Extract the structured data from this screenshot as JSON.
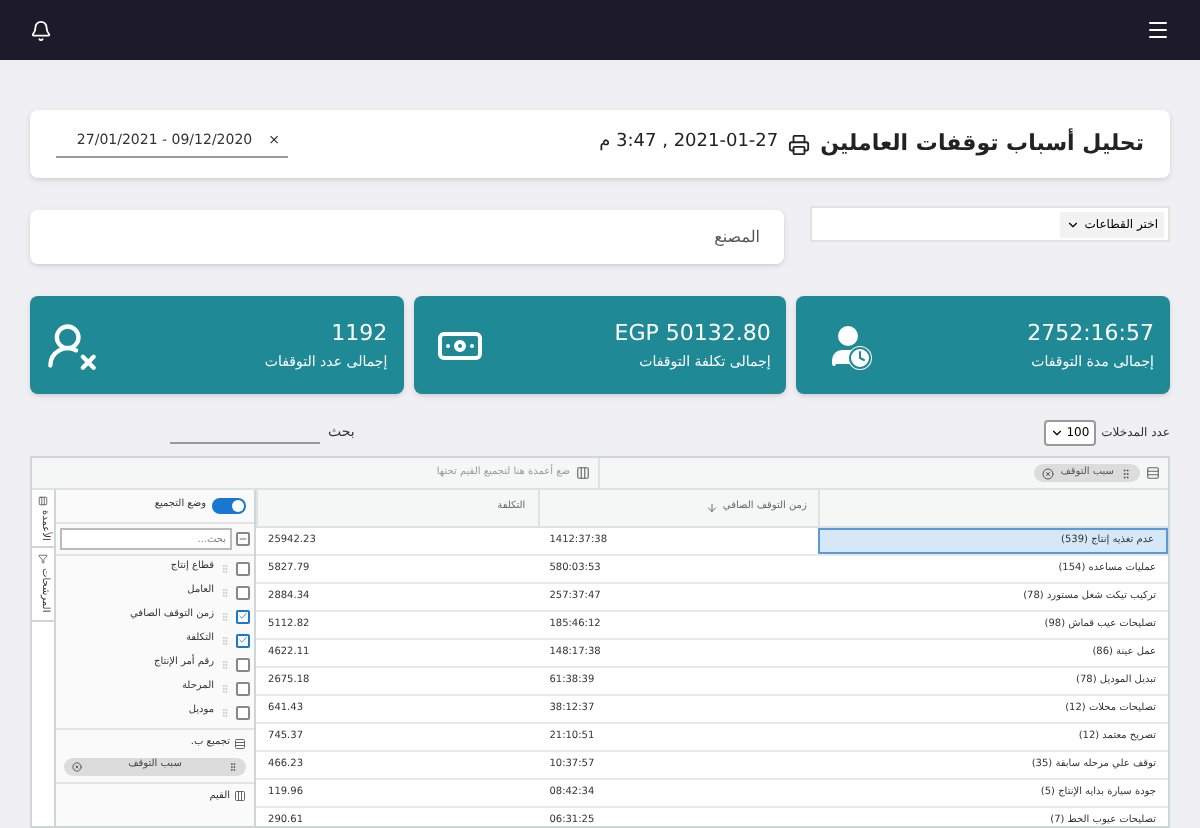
{
  "header": {
    "title": "تحليل أسباب توقفات العاملين",
    "datetime": "2021-01-27 , 3:47 م",
    "date_range": "09/12/2020 - 27/01/2021",
    "clear": "×"
  },
  "sector_select": {
    "label": "اختر القطاعات"
  },
  "factory_card": {
    "label": "المصنع"
  },
  "kpis": [
    {
      "kind": "duration",
      "value": "2752:16:57",
      "label": "إجمالى مدة التوقفات"
    },
    {
      "kind": "cost",
      "value": "EGP 50132.80",
      "label": "إجمالى تكلفة التوقفات"
    },
    {
      "kind": "count",
      "value": "1192",
      "label": "إجمالى عدد التوقفات"
    }
  ],
  "entries": {
    "label": "عدد المدخلات",
    "value": "100"
  },
  "search": {
    "label": "بحث"
  },
  "grid": {
    "group_chip": "سبب التوقف",
    "drop_hint": "ضع أعمدة هنا لتجميع القيم تحتها",
    "columns": [
      {
        "label": "زمن التوقف الصافي",
        "sorted": true
      },
      {
        "label": "التكلفة",
        "sorted": false
      }
    ],
    "rows": [
      {
        "cause": "عدم تغذيه إنتاج (539)",
        "time": "1412:37:38",
        "cost": "25942.23",
        "selected": true
      },
      {
        "cause": "عمليات مساعده (154)",
        "time": "580:03:53",
        "cost": "5827.79",
        "selected": false
      },
      {
        "cause": "تركيب تيكت شغل مستورد (78)",
        "time": "257:37:47",
        "cost": "2884.34",
        "selected": false
      },
      {
        "cause": "تصليحات عيب قماش (98)",
        "time": "185:46:12",
        "cost": "5112.82",
        "selected": false
      },
      {
        "cause": "عمل عينة (86)",
        "time": "148:17:38",
        "cost": "4622.11",
        "selected": false
      },
      {
        "cause": "تبديل الموديل (78)",
        "time": "61:38:39",
        "cost": "2675.18",
        "selected": false
      },
      {
        "cause": "تصليحات محلات (12)",
        "time": "38:12:37",
        "cost": "641.43",
        "selected": false
      },
      {
        "cause": "تصريح معتمد (12)",
        "time": "21:10:51",
        "cost": "745.37",
        "selected": false
      },
      {
        "cause": "توقف علي مرحله سابقة (35)",
        "time": "10:37:57",
        "cost": "466.23",
        "selected": false
      },
      {
        "cause": "جودة سيارة بدايه الإنتاج (5)",
        "time": "08:42:34",
        "cost": "119.96",
        "selected": false
      },
      {
        "cause": "تصليحات عيوب الخط (7)",
        "time": "06:31:25",
        "cost": "290.61",
        "selected": false
      }
    ]
  },
  "side_tabs": [
    {
      "label": "الأعمدة",
      "kind": "columns"
    },
    {
      "label": "المرشحات",
      "kind": "filters"
    }
  ],
  "panel": {
    "pivot_toggle": {
      "label": "وضع التجميع",
      "on": true
    },
    "search_placeholder": "بحث...",
    "columns": [
      {
        "label": "قطاع إنتاج",
        "checked": false
      },
      {
        "label": "العامل",
        "checked": false
      },
      {
        "label": "زمن التوقف الصافي",
        "checked": true
      },
      {
        "label": "التكلفة",
        "checked": true
      },
      {
        "label": "رقم أمر الإنتاج",
        "checked": false
      },
      {
        "label": "المرحلة",
        "checked": false
      },
      {
        "label": "موديل",
        "checked": false
      }
    ],
    "group_by": {
      "label": "تجميع ب.",
      "chips": [
        "سبب التوقف"
      ]
    },
    "values": {
      "label": "القيم"
    }
  }
}
